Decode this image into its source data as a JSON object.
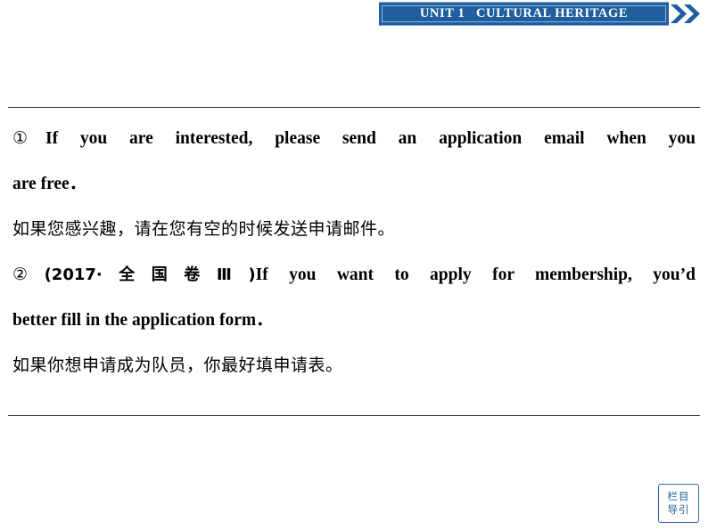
{
  "header": {
    "unit_label": "UNIT 1",
    "title": "CULTURAL HERITAGE",
    "full_title": "UNIT 1   CULTURAL HERITAGE",
    "chevrons_icon": "double-chevron-right-icon",
    "accent_color": "#1f5fa0"
  },
  "content": {
    "items": [
      {
        "marker": "①",
        "english_line1": "If you are interested, please send an application email when you",
        "english_line2": "are free．",
        "chinese": "如果您感兴趣，请在您有空的时候发送申请邮件。"
      },
      {
        "marker": "②",
        "source": "(2017·全国卷Ⅲ)",
        "english_line1": "If you want to apply for membership, you’d",
        "english_line2": "better fill in the application form．",
        "chinese": "如果你想申请成为队员，你最好填申请表。"
      }
    ]
  },
  "nav_button": {
    "line1": "栏目",
    "line2": "导引"
  }
}
